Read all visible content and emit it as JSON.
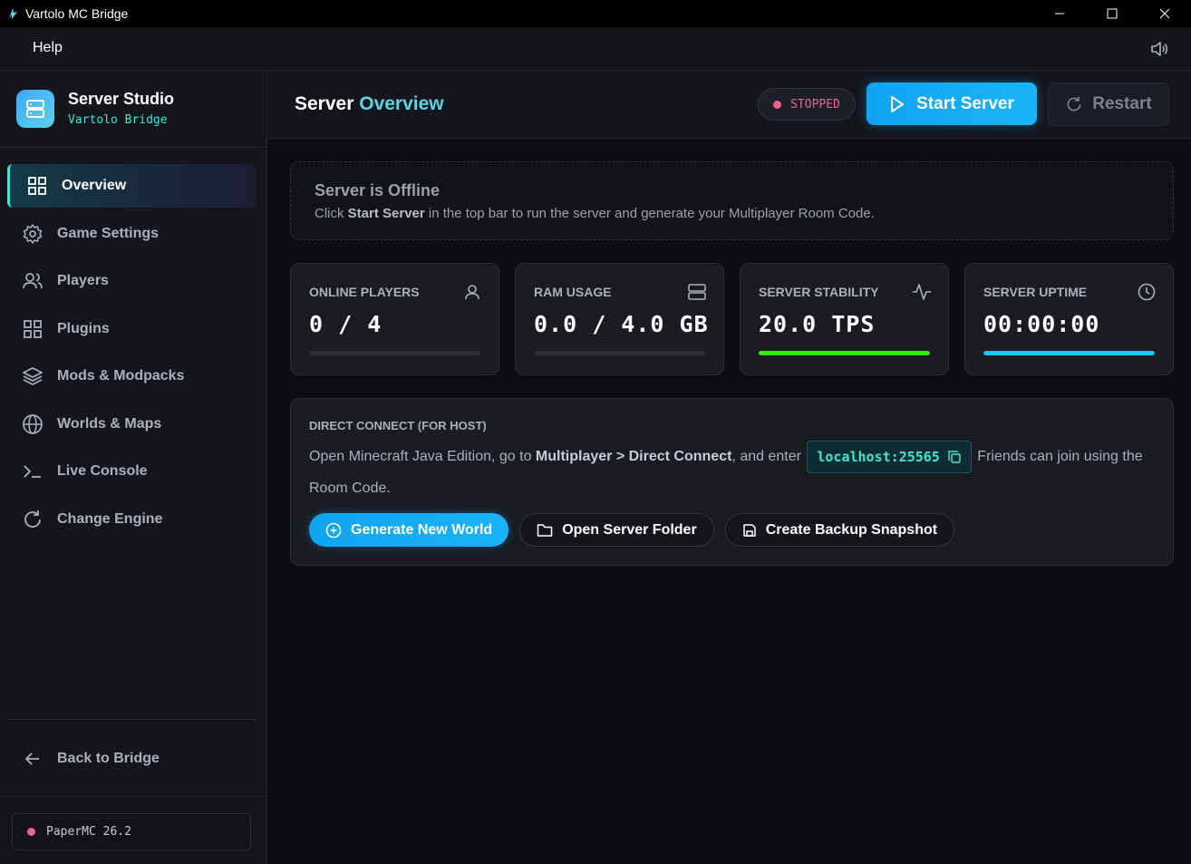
{
  "window": {
    "title": "Vartolo MC Bridge"
  },
  "menu": {
    "help": "Help"
  },
  "brand": {
    "title": "Server Studio",
    "subtitle": "Vartolo Bridge"
  },
  "nav": {
    "items": [
      {
        "label": "Overview",
        "icon": "grid-icon",
        "active": true
      },
      {
        "label": "Game Settings",
        "icon": "gear-icon",
        "active": false
      },
      {
        "label": "Players",
        "icon": "users-icon",
        "active": false
      },
      {
        "label": "Plugins",
        "icon": "grid-icon",
        "active": false
      },
      {
        "label": "Mods & Modpacks",
        "icon": "layers-icon",
        "active": false
      },
      {
        "label": "Worlds & Maps",
        "icon": "globe-icon",
        "active": false
      },
      {
        "label": "Live Console",
        "icon": "terminal-icon",
        "active": false
      },
      {
        "label": "Change Engine",
        "icon": "refresh-icon",
        "active": false
      }
    ],
    "back": "Back to Bridge"
  },
  "engine": {
    "label": "PaperMC 26.2",
    "status_color": "#f0628a"
  },
  "header": {
    "title_prefix": "Server",
    "title_accent": "Overview",
    "status": "STOPPED",
    "start": "Start Server",
    "restart": "Restart"
  },
  "offline": {
    "title": "Server is Offline",
    "desc_before": "Click",
    "desc_bold": "Start Server",
    "desc_after": "in the top bar to run the server and generate your Multiplayer Room Code."
  },
  "stats": [
    {
      "label": "ONLINE PLAYERS",
      "value": "0 / 4",
      "icon": "user-icon",
      "progress": 0,
      "color": "#2b2e36"
    },
    {
      "label": "RAM USAGE",
      "value": "0.0 / 4.0 GB",
      "icon": "server-icon",
      "progress": 0,
      "color": "#2b2e36"
    },
    {
      "label": "SERVER STABILITY",
      "value": "20.0 TPS",
      "icon": "activity-icon",
      "progress": 1,
      "color": "#39e617"
    },
    {
      "label": "SERVER UPTIME",
      "value": "00:00:00",
      "icon": "clock-icon",
      "progress": 1,
      "color": "#17c8f0"
    }
  ],
  "direct": {
    "heading": "DIRECT CONNECT (FOR HOST)",
    "text_1": "Open Minecraft Java Edition, go to",
    "text_bold": "Multiplayer > Direct Connect",
    "text_2": ", and enter",
    "address": "localhost:25565",
    "text_3": "Friends can join using the Room Code.",
    "actions": {
      "generate": "Generate New World",
      "open_folder": "Open Server Folder",
      "backup": "Create Backup Snapshot"
    }
  },
  "colors": {
    "accent": "#5ad4e6",
    "primary": "#0fa4f0",
    "danger": "#f0628a",
    "success": "#39e617"
  }
}
